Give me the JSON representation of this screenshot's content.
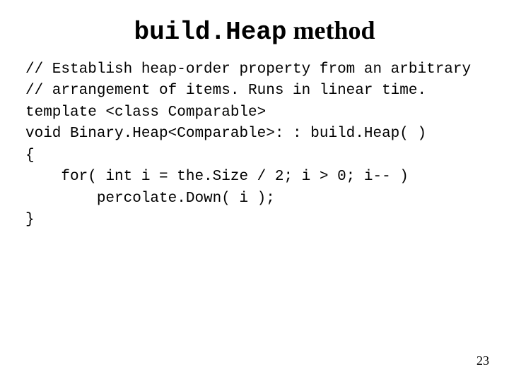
{
  "title": {
    "mono_part": "build.Heap",
    "serif_part": " method"
  },
  "code": {
    "l1": "// Establish heap-order property from an arbitrary",
    "l2": "// arrangement of items. Runs in linear time.",
    "l3": "template <class Comparable>",
    "l4": "void Binary.Heap<Comparable>: : build.Heap( )",
    "l5": "{",
    "l6": "    for( int i = the.Size / 2; i > 0; i-- )",
    "l7": "        percolate.Down( i );",
    "l8": "}"
  },
  "page_number": "23"
}
